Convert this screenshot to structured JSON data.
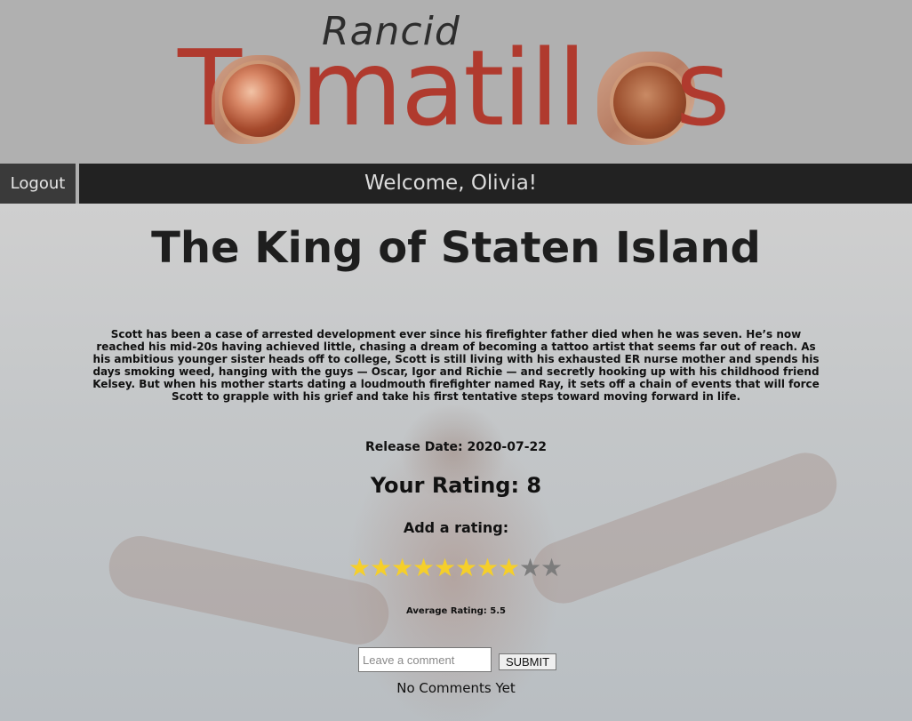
{
  "header": {
    "logo_top": "Rancid",
    "logo_word_left": "T",
    "logo_word_mid": "matill",
    "logo_word_right": "s"
  },
  "nav": {
    "logout_label": "Logout",
    "welcome_text": "Welcome, Olivia!"
  },
  "movie": {
    "title": "The King of Staten Island",
    "overview": "Scott has been a case of arrested development ever since his firefighter father died when he was seven. He’s now reached his mid-20s having achieved little, chasing a dream of becoming a tattoo artist that seems far out of reach. As his ambitious younger sister heads off to college, Scott is still living with his exhausted ER nurse mother and spends his days smoking weed, hanging with the guys — Oscar, Igor and Richie — and secretly hooking up with his childhood friend Kelsey. But when his mother starts dating a loudmouth firefighter named Ray, it sets off a chain of events that will force Scott to grapple with his grief and take his first tentative steps toward moving forward in life.",
    "release_date_text": "Release Date: 2020-07-22",
    "your_rating_text": "Your Rating: 8",
    "add_rating_label": "Add a rating:",
    "average_rating_text": "Average Rating: 5.5"
  },
  "rating": {
    "max_stars": 10,
    "selected": 8,
    "star_glyph": "★",
    "color_on": "#f5cf2a",
    "color_off": "#7c7c7c"
  },
  "comments": {
    "placeholder": "Leave a comment",
    "submit_label": "SUBMIT",
    "empty_text": "No Comments Yet"
  },
  "colors": {
    "nav_bg": "#222222",
    "logo_red": "#b03a2e"
  }
}
